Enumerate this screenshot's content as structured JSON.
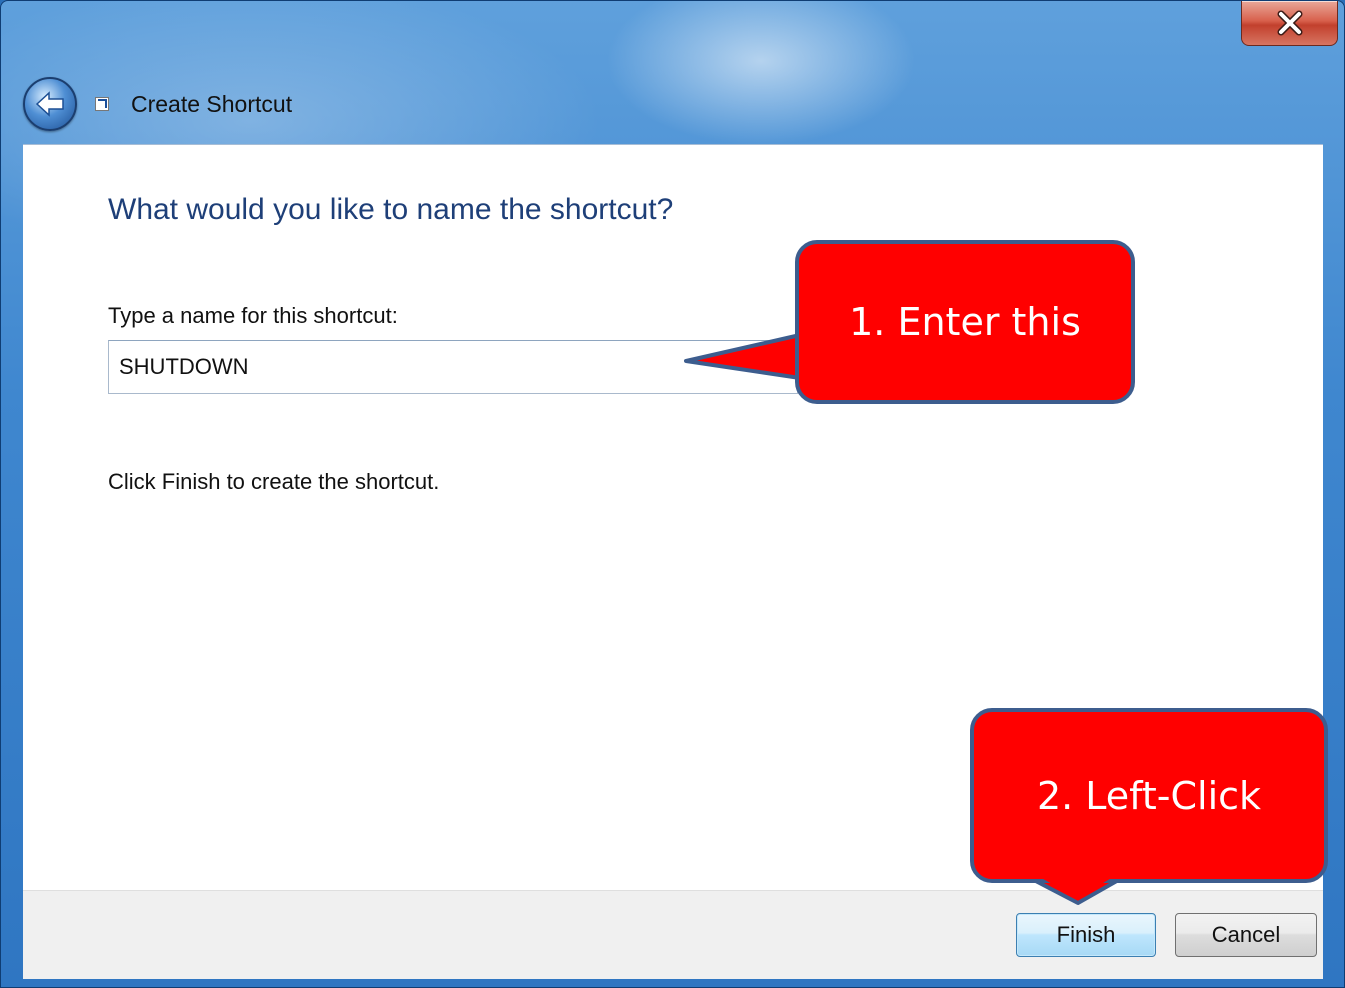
{
  "window": {
    "title": "Create Shortcut",
    "close_label": "x"
  },
  "wizard": {
    "heading": "What would you like to name the shortcut?",
    "field_label": "Type a name for this shortcut:",
    "field_value": "SHUTDOWN",
    "instruction": "Click Finish to create the shortcut."
  },
  "buttons": {
    "finish": "Finish",
    "cancel": "Cancel"
  },
  "callouts": {
    "step1": "1.  Enter this",
    "step2": "2.  Left-Click"
  },
  "colors": {
    "callout_fill": "#ff0000",
    "callout_border": "#3d5d8e",
    "heading": "#1e3f78"
  }
}
